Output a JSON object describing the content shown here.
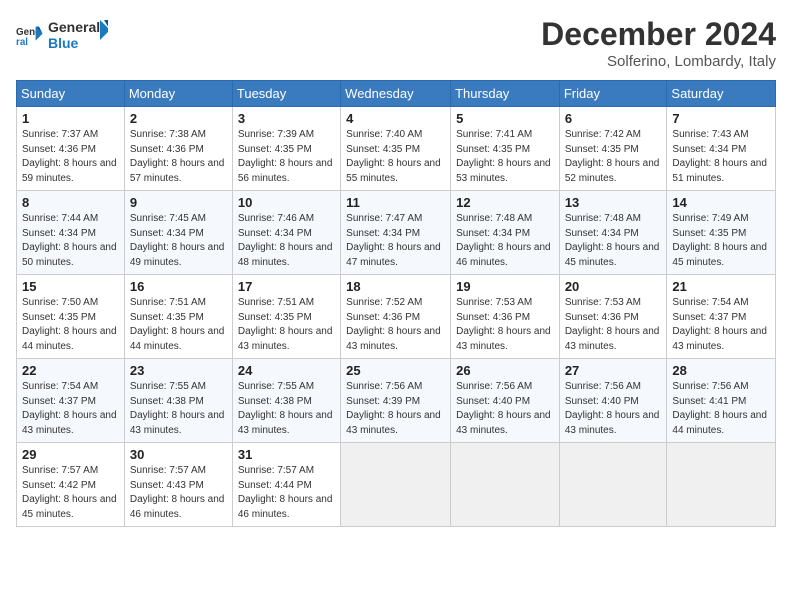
{
  "logo": {
    "line1": "General",
    "line2": "Blue"
  },
  "title": "December 2024",
  "location": "Solferino, Lombardy, Italy",
  "days_of_week": [
    "Sunday",
    "Monday",
    "Tuesday",
    "Wednesday",
    "Thursday",
    "Friday",
    "Saturday"
  ],
  "weeks": [
    [
      {
        "day": "1",
        "sunrise": "7:37 AM",
        "sunset": "4:36 PM",
        "daylight": "8 hours and 59 minutes."
      },
      {
        "day": "2",
        "sunrise": "7:38 AM",
        "sunset": "4:36 PM",
        "daylight": "8 hours and 57 minutes."
      },
      {
        "day": "3",
        "sunrise": "7:39 AM",
        "sunset": "4:35 PM",
        "daylight": "8 hours and 56 minutes."
      },
      {
        "day": "4",
        "sunrise": "7:40 AM",
        "sunset": "4:35 PM",
        "daylight": "8 hours and 55 minutes."
      },
      {
        "day": "5",
        "sunrise": "7:41 AM",
        "sunset": "4:35 PM",
        "daylight": "8 hours and 53 minutes."
      },
      {
        "day": "6",
        "sunrise": "7:42 AM",
        "sunset": "4:35 PM",
        "daylight": "8 hours and 52 minutes."
      },
      {
        "day": "7",
        "sunrise": "7:43 AM",
        "sunset": "4:34 PM",
        "daylight": "8 hours and 51 minutes."
      }
    ],
    [
      {
        "day": "8",
        "sunrise": "7:44 AM",
        "sunset": "4:34 PM",
        "daylight": "8 hours and 50 minutes."
      },
      {
        "day": "9",
        "sunrise": "7:45 AM",
        "sunset": "4:34 PM",
        "daylight": "8 hours and 49 minutes."
      },
      {
        "day": "10",
        "sunrise": "7:46 AM",
        "sunset": "4:34 PM",
        "daylight": "8 hours and 48 minutes."
      },
      {
        "day": "11",
        "sunrise": "7:47 AM",
        "sunset": "4:34 PM",
        "daylight": "8 hours and 47 minutes."
      },
      {
        "day": "12",
        "sunrise": "7:48 AM",
        "sunset": "4:34 PM",
        "daylight": "8 hours and 46 minutes."
      },
      {
        "day": "13",
        "sunrise": "7:48 AM",
        "sunset": "4:34 PM",
        "daylight": "8 hours and 45 minutes."
      },
      {
        "day": "14",
        "sunrise": "7:49 AM",
        "sunset": "4:35 PM",
        "daylight": "8 hours and 45 minutes."
      }
    ],
    [
      {
        "day": "15",
        "sunrise": "7:50 AM",
        "sunset": "4:35 PM",
        "daylight": "8 hours and 44 minutes."
      },
      {
        "day": "16",
        "sunrise": "7:51 AM",
        "sunset": "4:35 PM",
        "daylight": "8 hours and 44 minutes."
      },
      {
        "day": "17",
        "sunrise": "7:51 AM",
        "sunset": "4:35 PM",
        "daylight": "8 hours and 43 minutes."
      },
      {
        "day": "18",
        "sunrise": "7:52 AM",
        "sunset": "4:36 PM",
        "daylight": "8 hours and 43 minutes."
      },
      {
        "day": "19",
        "sunrise": "7:53 AM",
        "sunset": "4:36 PM",
        "daylight": "8 hours and 43 minutes."
      },
      {
        "day": "20",
        "sunrise": "7:53 AM",
        "sunset": "4:36 PM",
        "daylight": "8 hours and 43 minutes."
      },
      {
        "day": "21",
        "sunrise": "7:54 AM",
        "sunset": "4:37 PM",
        "daylight": "8 hours and 43 minutes."
      }
    ],
    [
      {
        "day": "22",
        "sunrise": "7:54 AM",
        "sunset": "4:37 PM",
        "daylight": "8 hours and 43 minutes."
      },
      {
        "day": "23",
        "sunrise": "7:55 AM",
        "sunset": "4:38 PM",
        "daylight": "8 hours and 43 minutes."
      },
      {
        "day": "24",
        "sunrise": "7:55 AM",
        "sunset": "4:38 PM",
        "daylight": "8 hours and 43 minutes."
      },
      {
        "day": "25",
        "sunrise": "7:56 AM",
        "sunset": "4:39 PM",
        "daylight": "8 hours and 43 minutes."
      },
      {
        "day": "26",
        "sunrise": "7:56 AM",
        "sunset": "4:40 PM",
        "daylight": "8 hours and 43 minutes."
      },
      {
        "day": "27",
        "sunrise": "7:56 AM",
        "sunset": "4:40 PM",
        "daylight": "8 hours and 43 minutes."
      },
      {
        "day": "28",
        "sunrise": "7:56 AM",
        "sunset": "4:41 PM",
        "daylight": "8 hours and 44 minutes."
      }
    ],
    [
      {
        "day": "29",
        "sunrise": "7:57 AM",
        "sunset": "4:42 PM",
        "daylight": "8 hours and 45 minutes."
      },
      {
        "day": "30",
        "sunrise": "7:57 AM",
        "sunset": "4:43 PM",
        "daylight": "8 hours and 46 minutes."
      },
      {
        "day": "31",
        "sunrise": "7:57 AM",
        "sunset": "4:44 PM",
        "daylight": "8 hours and 46 minutes."
      },
      null,
      null,
      null,
      null
    ]
  ]
}
